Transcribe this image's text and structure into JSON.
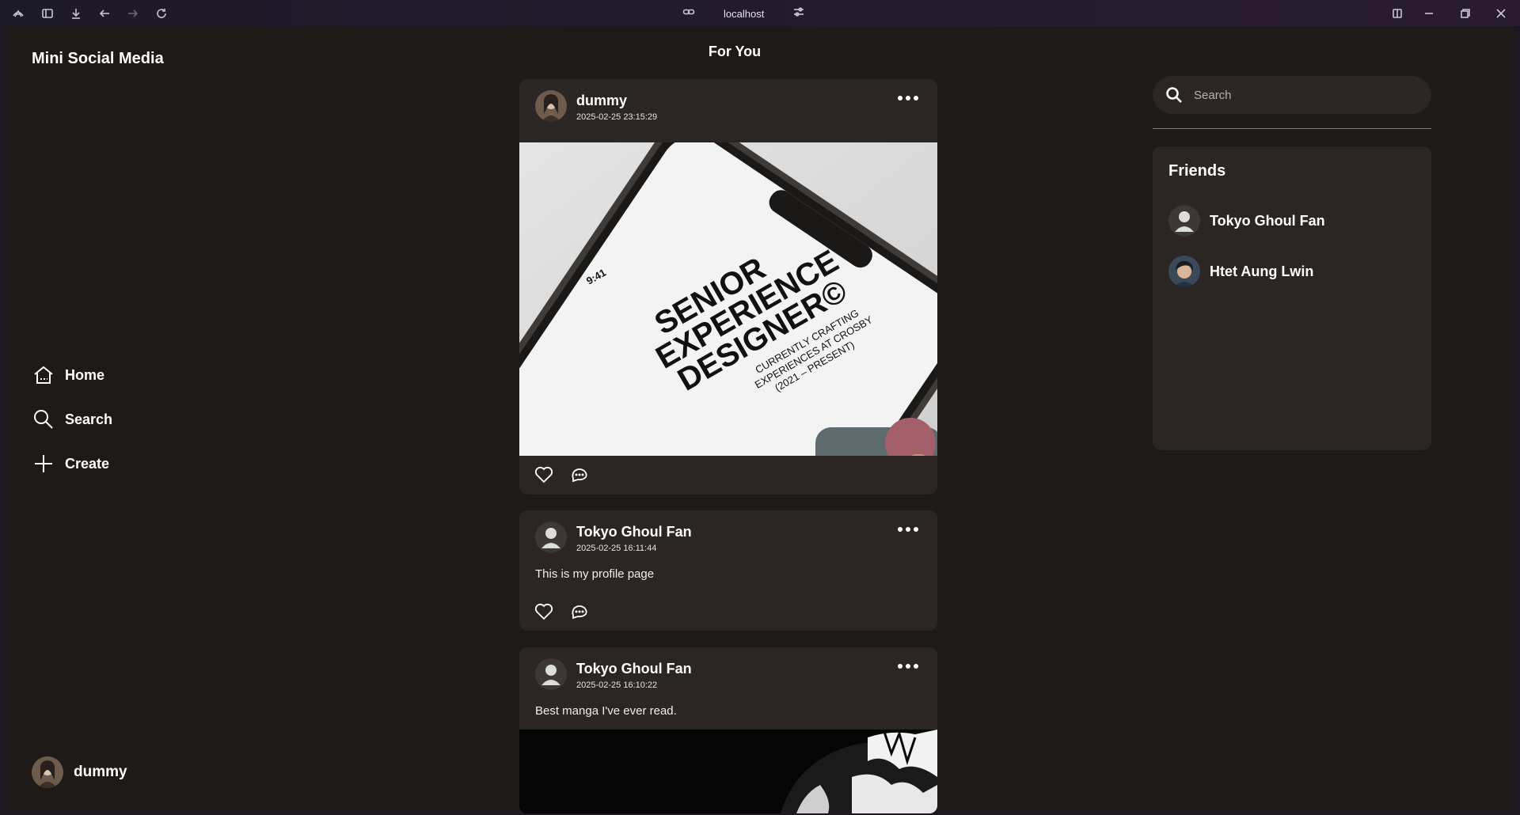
{
  "browser": {
    "url": "localhost"
  },
  "app": {
    "brand": "Mini Social Media"
  },
  "sidebar": {
    "items": [
      {
        "label": "Home",
        "icon": "home-icon"
      },
      {
        "label": "Search",
        "icon": "search-icon"
      },
      {
        "label": "Create",
        "icon": "plus-icon"
      }
    ],
    "current_user": "dummy"
  },
  "feed": {
    "title": "For You",
    "posts": [
      {
        "user": "dummy",
        "timestamp": "2025-02-25 23:15:29",
        "text": "",
        "image": {
          "line1": "SENIOR",
          "line2": "EXPERIENCE",
          "line3": "DESIGNER©",
          "sub1": "CURRENTLY CRAFTING",
          "sub2": "EXPERIENCES AT CROSBY",
          "sub3": "(2021 – PRESENT)",
          "clock": "9:41"
        }
      },
      {
        "user": "Tokyo Ghoul Fan",
        "timestamp": "2025-02-25 16:11:44",
        "text": "This is my profile page"
      },
      {
        "user": "Tokyo Ghoul Fan",
        "timestamp": "2025-02-25 16:10:22",
        "text": "Best manga I've ever read."
      }
    ]
  },
  "search": {
    "placeholder": "Search"
  },
  "friends": {
    "title": "Friends",
    "list": [
      {
        "name": "Tokyo Ghoul Fan"
      },
      {
        "name": "Htet Aung Lwin"
      }
    ]
  }
}
